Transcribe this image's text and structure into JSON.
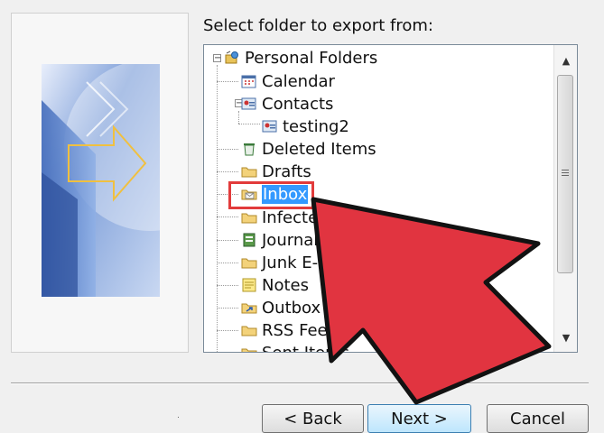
{
  "export_wizard": {
    "prompt": "Select folder to export from:",
    "tree": {
      "root": "Personal Folders",
      "items": {
        "calendar": "Calendar",
        "contacts": "Contacts",
        "testing2": "testing2",
        "deleted": "Deleted Items",
        "drafts": "Drafts",
        "inbox": "Inbox",
        "infected": "Infecte",
        "journal": "Journal",
        "junk": "Junk E-mai",
        "notes": "Notes",
        "outbox": "Outbox",
        "rss": "RSS Feeds",
        "sent": "Sent Items"
      },
      "selected": "Inbox"
    },
    "buttons": {
      "back": "< Back",
      "next": "Next >",
      "cancel": "Cancel"
    }
  },
  "colors": {
    "selection": "#3399ff",
    "annotation_red": "#e23b3b",
    "arrow_fill": "#e13440"
  }
}
